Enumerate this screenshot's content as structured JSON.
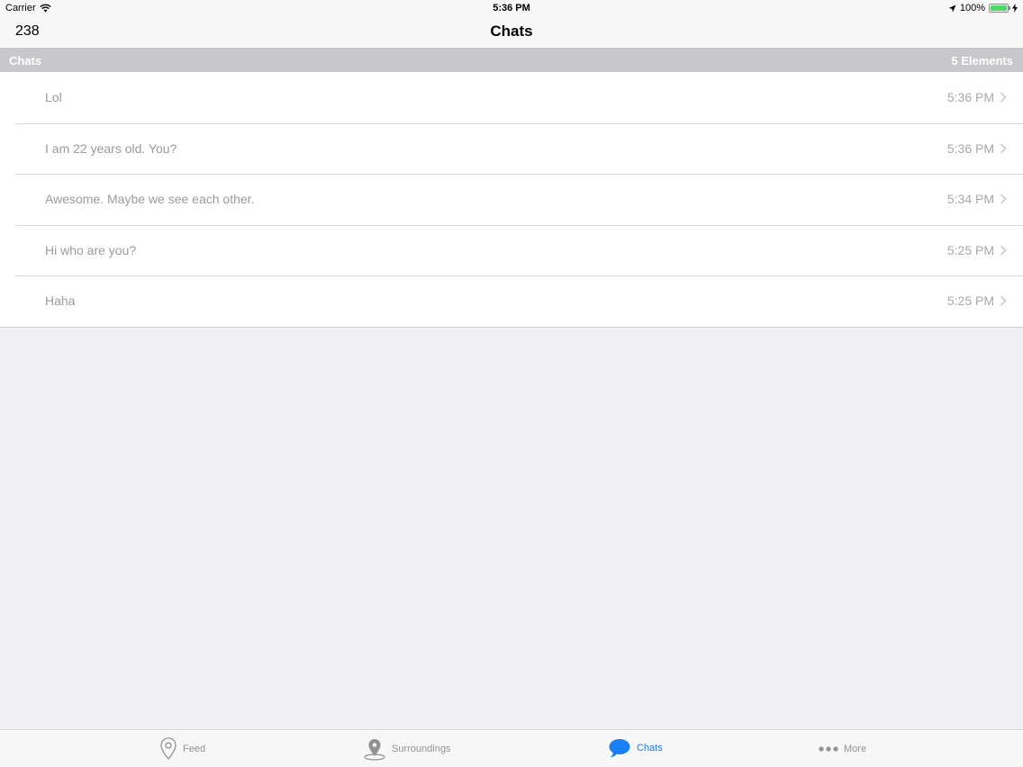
{
  "status_bar": {
    "carrier": "Carrier",
    "time": "5:36 PM",
    "battery_text": "100%",
    "battery_level": 1.0
  },
  "nav": {
    "left_count": "238",
    "title": "Chats"
  },
  "section": {
    "title": "Chats",
    "count_label": "5 Elements"
  },
  "chats": [
    {
      "message": "Lol",
      "time": "5:36 PM"
    },
    {
      "message": "I am 22 years old. You?",
      "time": "5:36 PM"
    },
    {
      "message": "Awesome. Maybe we see each other.",
      "time": "5:34 PM"
    },
    {
      "message": "Hi who are you?",
      "time": "5:25 PM"
    },
    {
      "message": "Haha",
      "time": "5:25 PM"
    }
  ],
  "tabs": [
    {
      "label": "Feed",
      "icon": "map-pin-outline-icon",
      "active": false
    },
    {
      "label": "Surroundings",
      "icon": "location-pin-icon",
      "active": false
    },
    {
      "label": "Chats",
      "icon": "chat-bubble-icon",
      "active": true
    },
    {
      "label": "More",
      "icon": "more-dots-icon",
      "active": false
    }
  ],
  "colors": {
    "accent": "#1a7ef5",
    "section_header": "#c8c8cc",
    "battery": "#4cd964"
  }
}
